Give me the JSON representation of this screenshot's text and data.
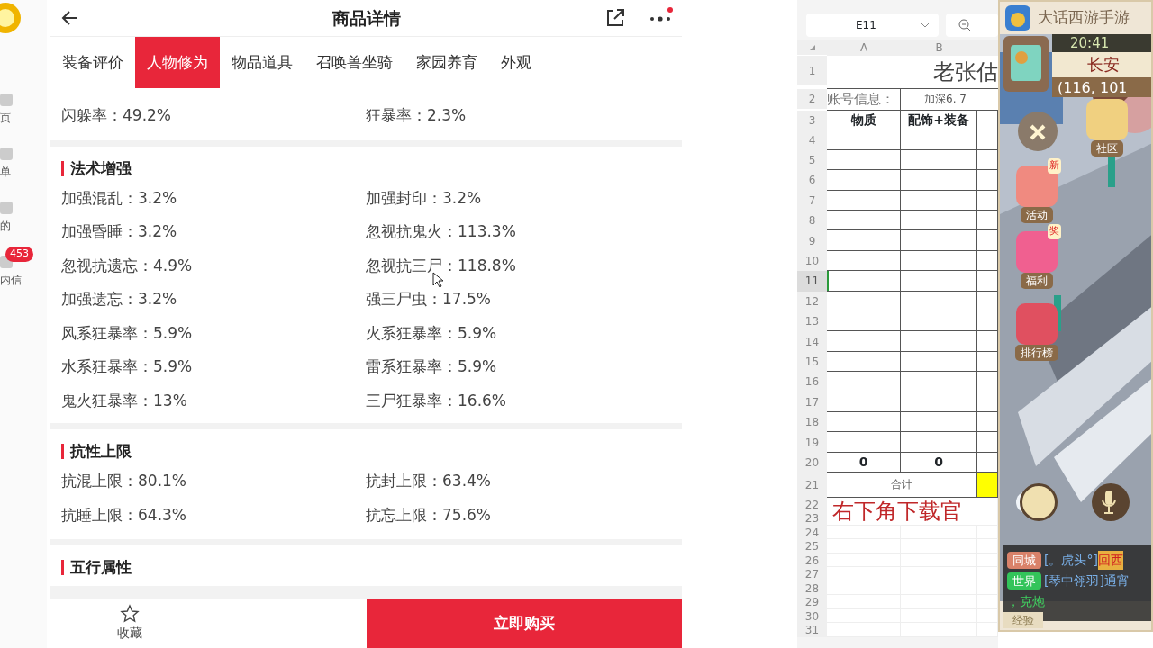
{
  "sidebar": {
    "items": [
      {
        "label": "页"
      },
      {
        "label": "单"
      },
      {
        "label": "的"
      },
      {
        "label": "内信",
        "badge": "453"
      }
    ]
  },
  "app": {
    "title": "商品详情",
    "tabs": [
      {
        "label": "装备评价",
        "selected": false
      },
      {
        "label": "人物修为",
        "selected": true
      },
      {
        "label": "物品道具",
        "selected": false
      },
      {
        "label": "召唤兽坐骑",
        "selected": false
      },
      {
        "label": "家园养育",
        "selected": false
      },
      {
        "label": "外观",
        "selected": false
      }
    ],
    "sections": [
      {
        "rows": [
          [
            "闪躲率：49.2%",
            "狂暴率：2.3%"
          ]
        ]
      },
      {
        "title": "法术增强",
        "rows": [
          [
            "加强混乱：3.2%",
            "加强封印：3.2%"
          ],
          [
            "加强昏睡：3.2%",
            "忽视抗鬼火：113.3%"
          ],
          [
            "忽视抗遗忘：4.9%",
            "忽视抗三尸：118.8%"
          ],
          [
            "加强遗忘：3.2%",
            "强三尸虫：17.5%"
          ],
          [
            "风系狂暴率：5.9%",
            "火系狂暴率：5.9%"
          ],
          [
            "水系狂暴率：5.9%",
            "雷系狂暴率：5.9%"
          ],
          [
            "鬼火狂暴率：13%",
            "三尸狂暴率：16.6%"
          ]
        ]
      },
      {
        "title": "抗性上限",
        "rows": [
          [
            "抗混上限：80.1%",
            "抗封上限：63.4%"
          ],
          [
            "抗睡上限：64.3%",
            "抗忘上限：75.6%"
          ]
        ]
      },
      {
        "title": "五行属性"
      }
    ],
    "favorite_label": "收藏",
    "buy_label": "立即购买"
  },
  "sheet": {
    "name_box": "E11",
    "columns": [
      "A",
      "B"
    ],
    "title": "老张估",
    "account_label": "账号信息：",
    "account_value": "加深6. 7",
    "headers": [
      "物质",
      "配饰+装备"
    ],
    "totals": [
      "0",
      "0"
    ],
    "total_label": "合计",
    "overlay_text": "右下角下载官",
    "rows": [
      {
        "number": "1",
        "selected": false
      },
      {
        "number": "2",
        "selected": false
      },
      {
        "number": "3",
        "selected": false
      },
      {
        "number": "4",
        "selected": false
      },
      {
        "number": "5",
        "selected": false
      },
      {
        "number": "6",
        "selected": false
      },
      {
        "number": "7",
        "selected": false
      },
      {
        "number": "8",
        "selected": false
      },
      {
        "number": "9",
        "selected": false
      },
      {
        "number": "10",
        "selected": false
      },
      {
        "number": "11",
        "selected": true
      },
      {
        "number": "12",
        "selected": false
      },
      {
        "number": "13",
        "selected": false
      },
      {
        "number": "14",
        "selected": false
      },
      {
        "number": "15",
        "selected": false
      },
      {
        "number": "16",
        "selected": false
      },
      {
        "number": "17",
        "selected": false
      },
      {
        "number": "18",
        "selected": false
      },
      {
        "number": "19",
        "selected": false
      },
      {
        "number": "20",
        "selected": false
      },
      {
        "number": "21",
        "selected": false
      },
      {
        "number": "22",
        "selected": false
      },
      {
        "number": "23",
        "selected": false
      },
      {
        "number": "24",
        "selected": false
      },
      {
        "number": "25",
        "selected": false
      },
      {
        "number": "26",
        "selected": false
      },
      {
        "number": "27",
        "selected": false
      },
      {
        "number": "28",
        "selected": false
      },
      {
        "number": "29",
        "selected": false
      },
      {
        "number": "30",
        "selected": false
      },
      {
        "number": "31",
        "selected": false
      }
    ]
  },
  "game": {
    "title": "大话西游手游",
    "time": "20:41",
    "location": "长安",
    "coords": "(116, 101",
    "buttons": [
      {
        "label": "社区"
      },
      {
        "label": "活动",
        "badge": "新"
      },
      {
        "label": "福利",
        "badge": "奖"
      },
      {
        "label": "排行榜"
      }
    ],
    "chat": [
      {
        "channel": "同城",
        "color": "#d9826a",
        "text": "[。虎头°]",
        "extra": "回西"
      },
      {
        "channel": "世界",
        "color": "#33c45a",
        "text": "[琴中翎羽]通宵"
      }
    ],
    "chat_tail": "，克炮",
    "tab": "经验"
  }
}
